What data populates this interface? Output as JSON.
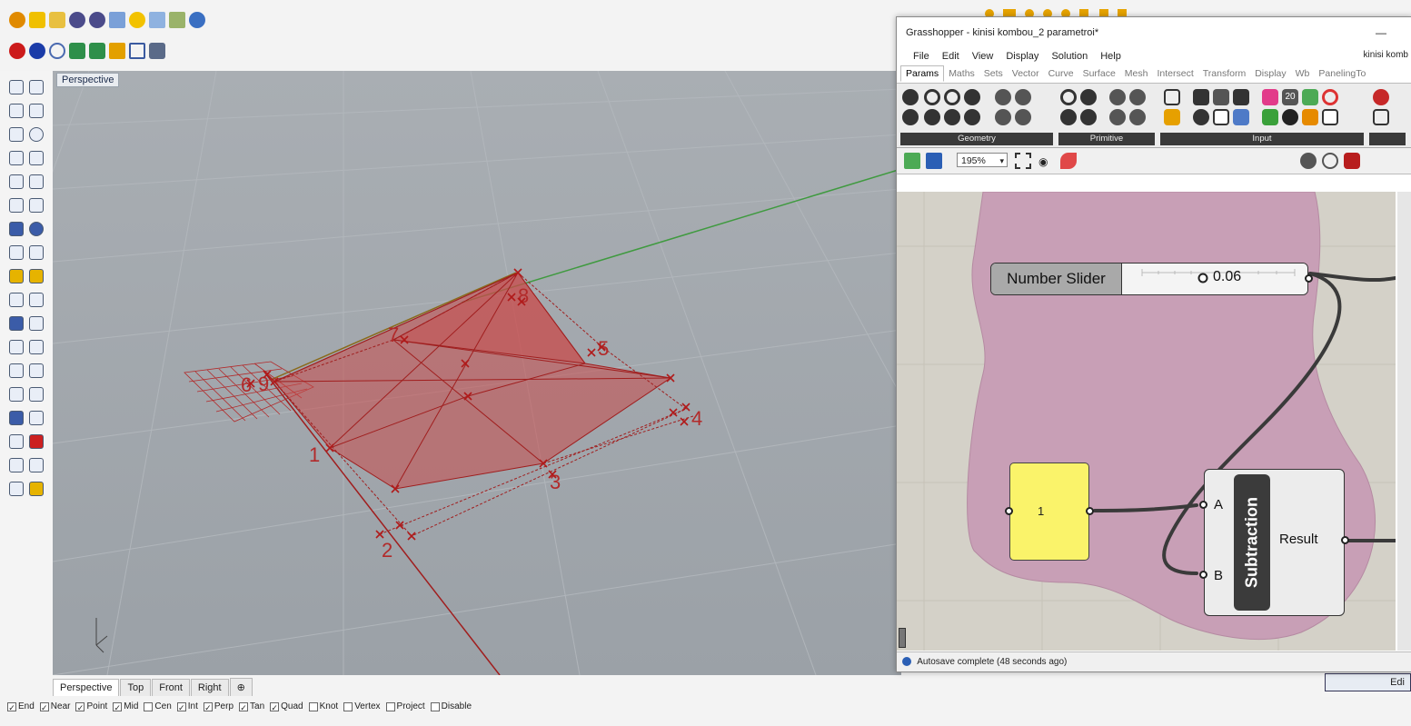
{
  "viewport": {
    "label": "Perspective",
    "point_labels": [
      "1",
      "2",
      "3",
      "4",
      "5",
      "6",
      "7",
      "8",
      "9"
    ]
  },
  "viewport_tabs": [
    "Perspective",
    "Top",
    "Front",
    "Right",
    "⊕"
  ],
  "osnaps": [
    {
      "label": "End",
      "checked": true
    },
    {
      "label": "Near",
      "checked": true
    },
    {
      "label": "Point",
      "checked": true
    },
    {
      "label": "Mid",
      "checked": true
    },
    {
      "label": "Cen",
      "checked": false
    },
    {
      "label": "Int",
      "checked": true
    },
    {
      "label": "Perp",
      "checked": true
    },
    {
      "label": "Tan",
      "checked": true
    },
    {
      "label": "Quad",
      "checked": true
    },
    {
      "label": "Knot",
      "checked": false
    },
    {
      "label": "Vertex",
      "checked": false
    },
    {
      "label": "Project",
      "checked": false
    },
    {
      "label": "Disable",
      "checked": false
    }
  ],
  "grasshopper": {
    "title": "Grasshopper - kinisi kombou_2 parametroi*",
    "title_right": "kinisi komb",
    "menu": [
      "File",
      "Edit",
      "View",
      "Display",
      "Solution",
      "Help"
    ],
    "tabs": [
      "Params",
      "Maths",
      "Sets",
      "Vector",
      "Curve",
      "Surface",
      "Mesh",
      "Intersect",
      "Transform",
      "Display",
      "Wb",
      "PanelingTo"
    ],
    "ribbon_groups": [
      "Geometry",
      "Primitive",
      "Input"
    ],
    "ribbon_badge": "20",
    "zoom": "195%",
    "slider": {
      "name": "Number Slider",
      "value": "0.06"
    },
    "panel": {
      "value": "1"
    },
    "subtraction": {
      "name": "Subtraction",
      "input_a": "A",
      "input_b": "B",
      "output": "Result"
    },
    "status": "Autosave complete (48 seconds ago)"
  },
  "rhino": {
    "edit_label": "Edi"
  }
}
